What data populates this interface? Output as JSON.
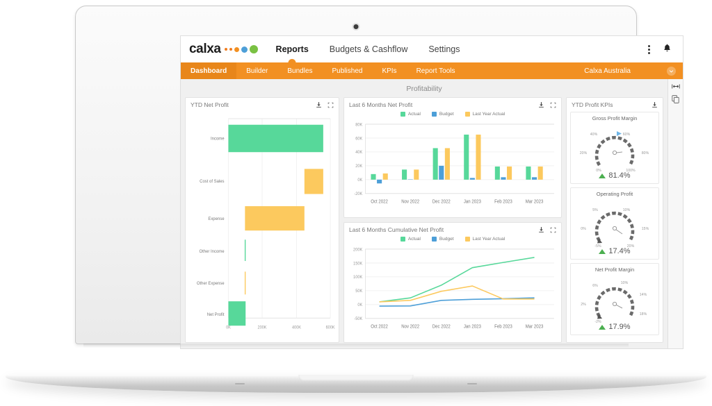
{
  "brand": {
    "logo_text": "calxa",
    "accent_orange": "#f29022",
    "accent_green": "#57d89a",
    "accent_blue": "#4d9fd8",
    "accent_yellow": "#fcc95e"
  },
  "topnav": {
    "items": [
      {
        "label": "Reports",
        "active": true
      },
      {
        "label": "Budgets & Cashflow",
        "active": false
      },
      {
        "label": "Settings",
        "active": false
      }
    ],
    "kebab_icon": "more-vertical-icon",
    "bell_icon": "notification-bell-icon"
  },
  "subnav": {
    "items": [
      {
        "label": "Dashboard",
        "active": true
      },
      {
        "label": "Builder",
        "active": false
      },
      {
        "label": "Bundles",
        "active": false
      },
      {
        "label": "Published",
        "active": false
      },
      {
        "label": "KPIs",
        "active": false
      },
      {
        "label": "Report Tools",
        "active": false
      }
    ],
    "organisation": "Calxa Australia",
    "chevron_icon": "chevron-down-icon"
  },
  "dashboard": {
    "title": "Profitability"
  },
  "rail": {
    "resize_icon": "horizontal-resize-icon",
    "duplicate_icon": "copy-duplicate-icon"
  },
  "panels": {
    "ytd_net_profit": {
      "title": "YTD Net Profit",
      "download_icon": "download-icon",
      "expand_icon": "expand-fullscreen-icon"
    },
    "last6_net_profit": {
      "title": "Last 6 Months Net Profit",
      "download_icon": "download-icon",
      "expand_icon": "expand-fullscreen-icon"
    },
    "last6_cumulative": {
      "title": "Last 6 Months Cumulative Net Profit",
      "download_icon": "download-icon",
      "expand_icon": "expand-fullscreen-icon"
    },
    "ytd_profit_kpis": {
      "title": "YTD Profit KPIs",
      "download_icon": "download-icon"
    }
  },
  "legend": [
    {
      "label": "Actual",
      "color": "#57d89a"
    },
    {
      "label": "Budget",
      "color": "#4d9fd8"
    },
    {
      "label": "Last Year Actual",
      "color": "#fcc95e"
    }
  ],
  "chart_data": [
    {
      "type": "bar",
      "id": "ytd-net-profit-waterfall",
      "title": "YTD Net Profit",
      "orientation": "horizontal",
      "subtype": "waterfall",
      "categories": [
        "Income",
        "Cost of Sales",
        "Expense",
        "Other Income",
        "Other Expense",
        "Net Profit"
      ],
      "bars": [
        {
          "category": "Income",
          "start": 0,
          "end": 605000,
          "color": "#57d89a"
        },
        {
          "category": "Cost of Sales",
          "start": 485000,
          "end": 605000,
          "color": "#fcc95e"
        },
        {
          "category": "Expense",
          "start": 106000,
          "end": 485000,
          "color": "#fcc95e"
        },
        {
          "category": "Other Income",
          "start": 104000,
          "end": 110000,
          "color": "#57d89a"
        },
        {
          "category": "Other Expense",
          "start": 104000,
          "end": 110000,
          "color": "#fcc95e"
        },
        {
          "category": "Net Profit",
          "start": 0,
          "end": 110000,
          "color": "#57d89a"
        }
      ],
      "xlabel": "",
      "ylabel": "",
      "xlim": [
        0,
        650000
      ],
      "xticks": [
        0,
        200000,
        400000,
        600000
      ],
      "xticklabels": [
        "0K",
        "200K",
        "400K",
        "600K"
      ],
      "grid": true,
      "legend": "none"
    },
    {
      "type": "bar",
      "id": "last6-net-profit",
      "title": "Last 6 Months Net Profit",
      "categories": [
        "Oct 2022",
        "Nov 2022",
        "Dec 2022",
        "Jan 2023",
        "Feb 2023",
        "Mar 2023"
      ],
      "series": [
        {
          "name": "Actual",
          "color": "#57d89a",
          "values": [
            8000,
            14500,
            45500,
            65000,
            19000,
            19000
          ]
        },
        {
          "name": "Budget",
          "color": "#4d9fd8",
          "values": [
            -5500,
            500,
            20000,
            2500,
            3500,
            3500
          ]
        },
        {
          "name": "Last Year Actual",
          "color": "#fcc95e",
          "values": [
            9000,
            14500,
            45500,
            65000,
            19000,
            19000
          ]
        }
      ],
      "xlabel": "",
      "ylabel": "",
      "ylim": [
        -20000,
        80000
      ],
      "yticks": [
        -20000,
        0,
        20000,
        40000,
        60000,
        80000
      ],
      "yticklabels": [
        "-20K",
        "0K",
        "20K",
        "40K",
        "60K",
        "80K"
      ],
      "grid": true,
      "legend": "top"
    },
    {
      "type": "line",
      "id": "last6-cumulative-net-profit",
      "title": "Last 6 Months Cumulative Net Profit",
      "categories": [
        "Oct 2022",
        "Nov 2022",
        "Dec 2022",
        "Jan 2023",
        "Feb 2023",
        "Mar 2023"
      ],
      "series": [
        {
          "name": "Actual",
          "color": "#57d89a",
          "values": [
            10000,
            24000,
            70000,
            133000,
            152000,
            170000
          ]
        },
        {
          "name": "Budget",
          "color": "#4d9fd8",
          "values": [
            -5500,
            -5000,
            15000,
            19000,
            21000,
            24000
          ]
        },
        {
          "name": "Last Year Actual",
          "color": "#fcc95e",
          "values": [
            10000,
            15000,
            48000,
            67000,
            20000,
            20000
          ]
        }
      ],
      "xlabel": "",
      "ylabel": "",
      "ylim": [
        -50000,
        200000
      ],
      "yticks": [
        -50000,
        0,
        50000,
        100000,
        150000,
        200000
      ],
      "yticklabels": [
        "-50K",
        "0K",
        "50K",
        "100K",
        "150K",
        "200K"
      ],
      "grid": true,
      "legend": "top"
    },
    {
      "type": "gauge",
      "id": "gross-profit-margin-gauge",
      "title": "Gross Profit Margin",
      "value": 81.4,
      "value_label": "81.4%",
      "min": 0,
      "max": 100,
      "ticklabels": [
        "0%",
        "20%",
        "40%",
        "60%",
        "80%",
        "100%"
      ],
      "trend": "up",
      "trend_color": "#4caf50"
    },
    {
      "type": "gauge",
      "id": "operating-profit-gauge",
      "title": "Operating Profit",
      "value": 17.4,
      "value_label": "17.4%",
      "min": -5,
      "max": 20,
      "ticklabels": [
        "-5%",
        "0%",
        "5%",
        "10%",
        "15%",
        "20%"
      ],
      "trend": "up",
      "trend_color": "#4caf50"
    },
    {
      "type": "gauge",
      "id": "net-profit-margin-gauge",
      "title": "Net Profit Margin",
      "value": 17.9,
      "value_label": "17.9%",
      "min": -2,
      "max": 18,
      "ticklabels": [
        "-2%",
        "2%",
        "6%",
        "10%",
        "14%",
        "18%"
      ],
      "trend": "up",
      "trend_color": "#4caf50"
    }
  ],
  "kpis": [
    {
      "title": "Gross Profit Margin",
      "value_label": "81.4%",
      "trend_icon": "trend-up-icon"
    },
    {
      "title": "Operating Profit",
      "value_label": "17.4%",
      "trend_icon": "trend-up-icon"
    },
    {
      "title": "Net Profit Margin",
      "value_label": "17.9%",
      "trend_icon": "trend-up-icon"
    }
  ]
}
